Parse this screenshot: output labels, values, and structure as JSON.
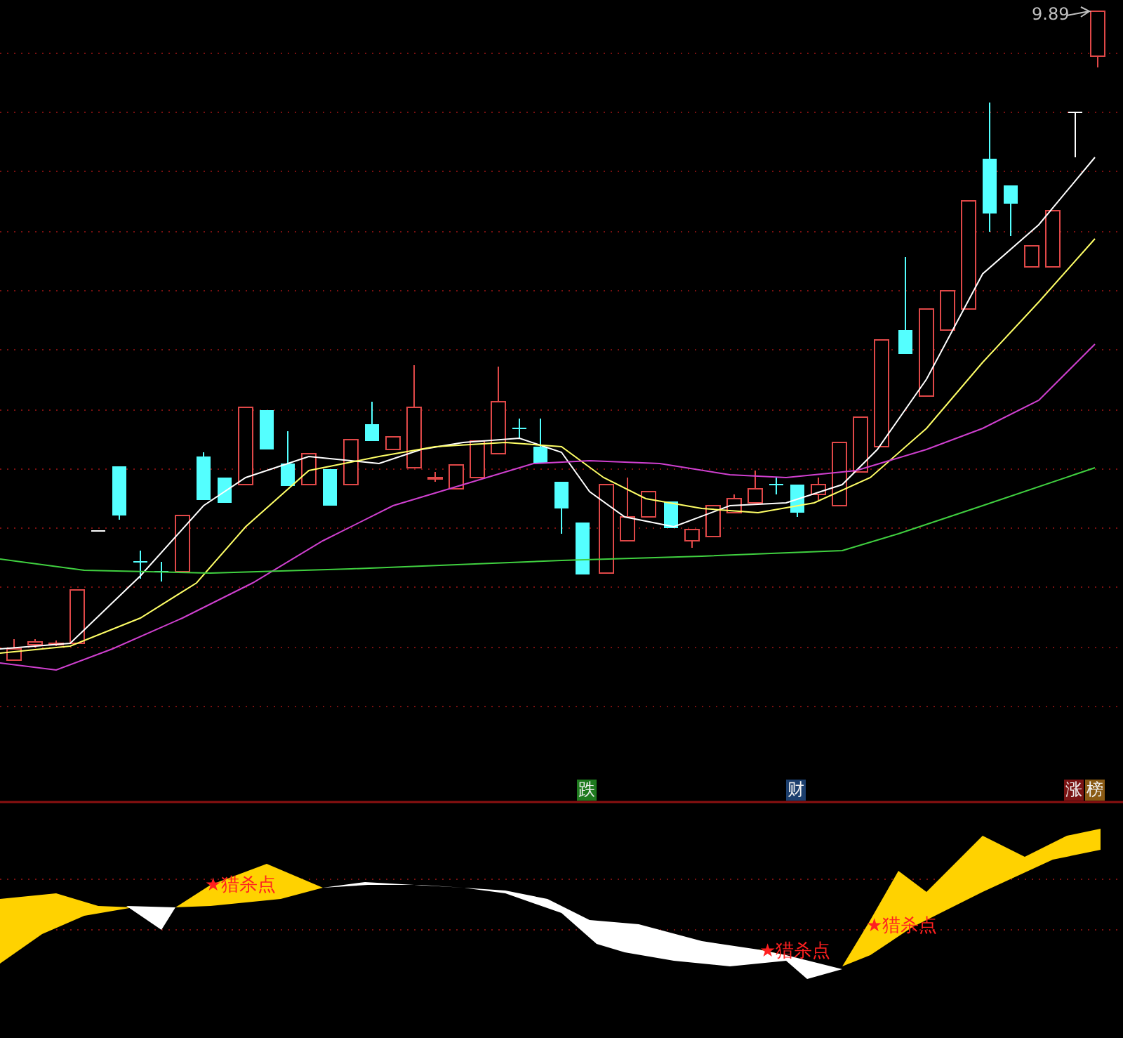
{
  "price_label": "9.89",
  "markers": [
    {
      "text": "跌",
      "color": "#1e7a1e"
    },
    {
      "text": "财",
      "color": "#1c3f6e"
    },
    {
      "text": "涨",
      "color": "#7a1414"
    },
    {
      "text": "榜",
      "color": "#8a5a14"
    }
  ],
  "signals": [
    "★猎杀点",
    "★猎杀点",
    "★猎杀点"
  ]
}
